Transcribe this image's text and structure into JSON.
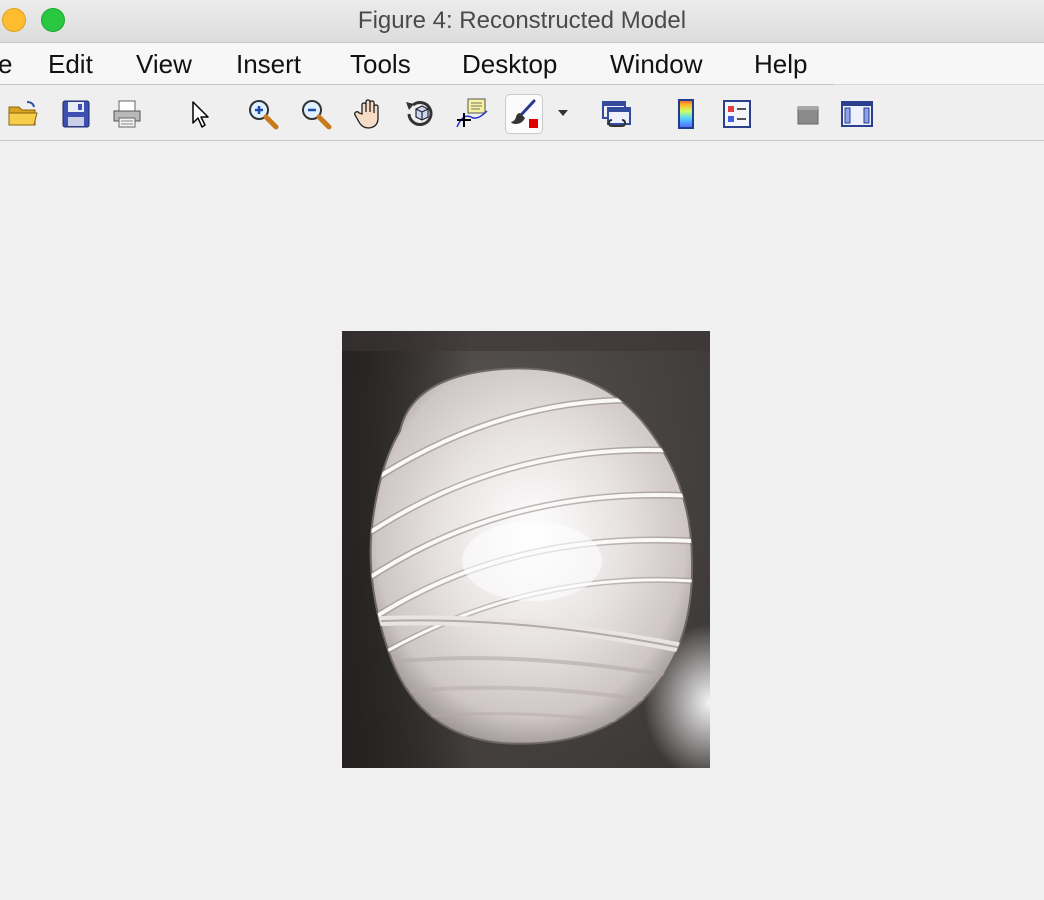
{
  "window": {
    "title": "Figure 4: Reconstructed Model"
  },
  "menu": {
    "items": [
      {
        "key": "file",
        "label": "e"
      },
      {
        "key": "edit",
        "label": "Edit"
      },
      {
        "key": "view",
        "label": "View"
      },
      {
        "key": "insert",
        "label": "Insert"
      },
      {
        "key": "tools",
        "label": "Tools"
      },
      {
        "key": "desktop",
        "label": "Desktop"
      },
      {
        "key": "window",
        "label": "Window"
      },
      {
        "key": "help",
        "label": "Help"
      }
    ]
  },
  "toolbar": {
    "buttons": [
      {
        "icon": "open-folder-icon"
      },
      {
        "icon": "save-icon"
      },
      {
        "icon": "print-icon"
      },
      {
        "icon": "pointer-icon"
      },
      {
        "icon": "zoom-in-icon"
      },
      {
        "icon": "zoom-out-icon"
      },
      {
        "icon": "pan-hand-icon"
      },
      {
        "icon": "rotate-3d-icon"
      },
      {
        "icon": "data-cursor-icon"
      },
      {
        "icon": "brush-icon",
        "state": "pressed"
      },
      {
        "icon": "link-plot-icon"
      },
      {
        "icon": "colorbar-icon"
      },
      {
        "icon": "legend-icon"
      },
      {
        "icon": "hide-plot-tools-icon"
      },
      {
        "icon": "show-plot-tools-icon"
      }
    ]
  },
  "figure": {
    "content": "image",
    "image_icon": "yarn-ball-image"
  },
  "colors": {
    "window_bg": "#f0f0f0",
    "close_yellow": "#febc2e",
    "zoom_green": "#28c840",
    "brush_red": "#e00000"
  }
}
